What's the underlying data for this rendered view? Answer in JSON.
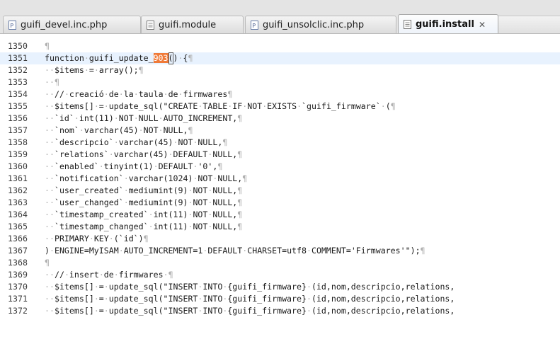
{
  "tabs": [
    {
      "label": "guifi_devel.inc.php",
      "active": false
    },
    {
      "label": "guifi.module",
      "active": false
    },
    {
      "label": "guifi_unsolclic.inc.php",
      "active": false
    },
    {
      "label": "guifi.install",
      "active": true,
      "close": "✕"
    }
  ],
  "editor": {
    "current_line": 1351,
    "selection_text": "903",
    "lines": [
      {
        "num": "1350",
        "code": "¶"
      },
      {
        "num": "1351",
        "code": "function·guifi_update_|SEL|903|/SEL|()·{¶"
      },
      {
        "num": "1352",
        "code": "··$items·=·array();¶"
      },
      {
        "num": "1353",
        "code": "··¶"
      },
      {
        "num": "1354",
        "code": "··//·creació·de·la·taula·de·firmwares¶"
      },
      {
        "num": "1355",
        "code": "··$items[]·=·update_sql(\"CREATE·TABLE·IF·NOT·EXISTS·`guifi_firmware`·(¶"
      },
      {
        "num": "1356",
        "code": "··`id`·int(11)·NOT·NULL·AUTO_INCREMENT,¶"
      },
      {
        "num": "1357",
        "code": "··`nom`·varchar(45)·NOT·NULL,¶"
      },
      {
        "num": "1358",
        "code": "··`descripcio`·varchar(45)·NOT·NULL,¶"
      },
      {
        "num": "1359",
        "code": "··`relations`·varchar(45)·DEFAULT·NULL,¶"
      },
      {
        "num": "1360",
        "code": "··`enabled`·tinyint(1)·DEFAULT·'0',¶"
      },
      {
        "num": "1361",
        "code": "··`notification`·varchar(1024)·NOT·NULL,¶"
      },
      {
        "num": "1362",
        "code": "··`user_created`·mediumint(9)·NOT·NULL,¶"
      },
      {
        "num": "1363",
        "code": "··`user_changed`·mediumint(9)·NOT·NULL,¶"
      },
      {
        "num": "1364",
        "code": "··`timestamp_created`·int(11)·NOT·NULL,¶"
      },
      {
        "num": "1365",
        "code": "··`timestamp_changed`·int(11)·NOT·NULL,¶"
      },
      {
        "num": "1366",
        "code": "··PRIMARY·KEY·(`id`)¶"
      },
      {
        "num": "1367",
        "code": ")·ENGINE=MyISAM·AUTO_INCREMENT=1·DEFAULT·CHARSET=utf8·COMMENT='Firmwares'\");¶"
      },
      {
        "num": "1368",
        "code": "¶"
      },
      {
        "num": "1369",
        "code": "··//·insert·de·firmwares·¶"
      },
      {
        "num": "1370",
        "code": "··$items[]·=·update_sql(\"INSERT·INTO·{guifi_firmware}·(id,nom,descripcio,relations,"
      },
      {
        "num": "1371",
        "code": "··$items[]·=·update_sql(\"INSERT·INTO·{guifi_firmware}·(id,nom,descripcio,relations,"
      },
      {
        "num": "1372",
        "code": "··$items[]·=·update_sql(\"INSERT·INTO·{guifi_firmware}·(id,nom,descripcio,relations,"
      }
    ]
  }
}
